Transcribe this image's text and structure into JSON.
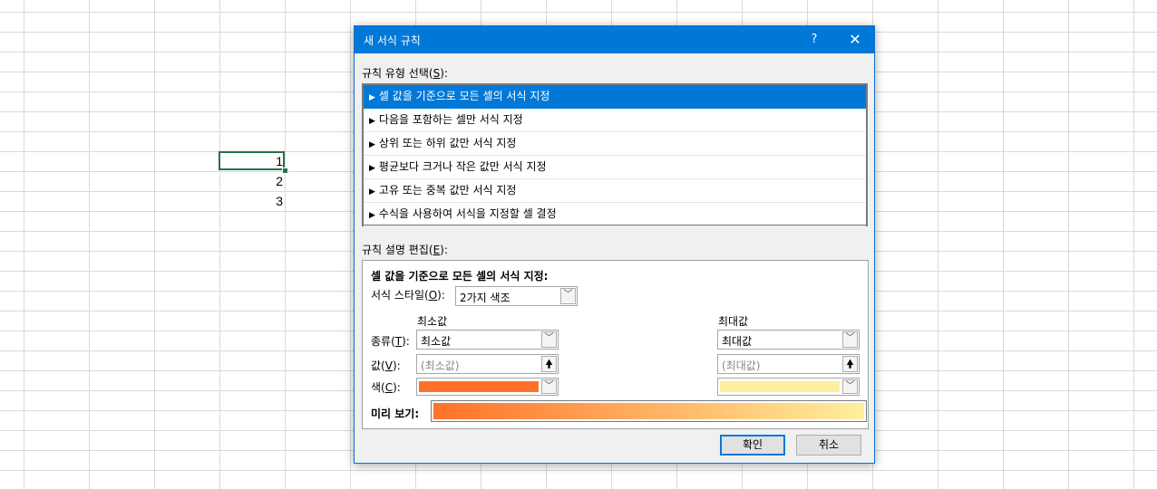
{
  "sheet": {
    "cells": [
      "1",
      "2",
      "3"
    ]
  },
  "dialog": {
    "title": "새 서식 규칙",
    "help": "?",
    "close": "✕",
    "select_rule_type": {
      "text": "규칙 유형 선택(",
      "key": "S",
      "tail": "):"
    },
    "rule_types": [
      "셀 값을 기준으로 모든 셀의 서식 지정",
      "다음을 포함하는 셀만 서식 지정",
      "상위 또는 하위 값만 서식 지정",
      "평균보다 크거나 작은 값만 서식 지정",
      "고유 또는 중복 값만 서식 지정",
      "수식을 사용하여 서식을 지정할 셀 결정"
    ],
    "edit_desc": {
      "text": "규칙 설명 편집(",
      "key": "E",
      "tail": "):"
    },
    "desc_heading": "셀 값을 기준으로 모든 셀의 서식 지정:",
    "format_style": {
      "text": "서식 스타일(",
      "key": "O",
      "tail": "):",
      "value": "2가지 색조"
    },
    "min_header": "최소값",
    "max_header": "최대값",
    "type_label": {
      "text": "종류(",
      "key": "T",
      "tail": "):"
    },
    "value_label": {
      "text": "값(",
      "key": "V",
      "tail": "):"
    },
    "color_label": {
      "text": "색(",
      "key": "C",
      "tail": "):"
    },
    "min_type": "최소값",
    "max_type": "최대값",
    "min_value_placeholder": "(최소값)",
    "max_value_placeholder": "(최대값)",
    "preview_label": "미리 보기:",
    "ok": "확인",
    "cancel": "취소"
  },
  "colors": {
    "accent": "#0078d7",
    "min_color": "#ff7128",
    "max_color": "#ffef9c",
    "cell_border": "#217346"
  },
  "icons": {
    "dropdown": "chevron-down-icon",
    "collapse": "range-selector-icon",
    "bullet": "triangle-right-icon"
  }
}
